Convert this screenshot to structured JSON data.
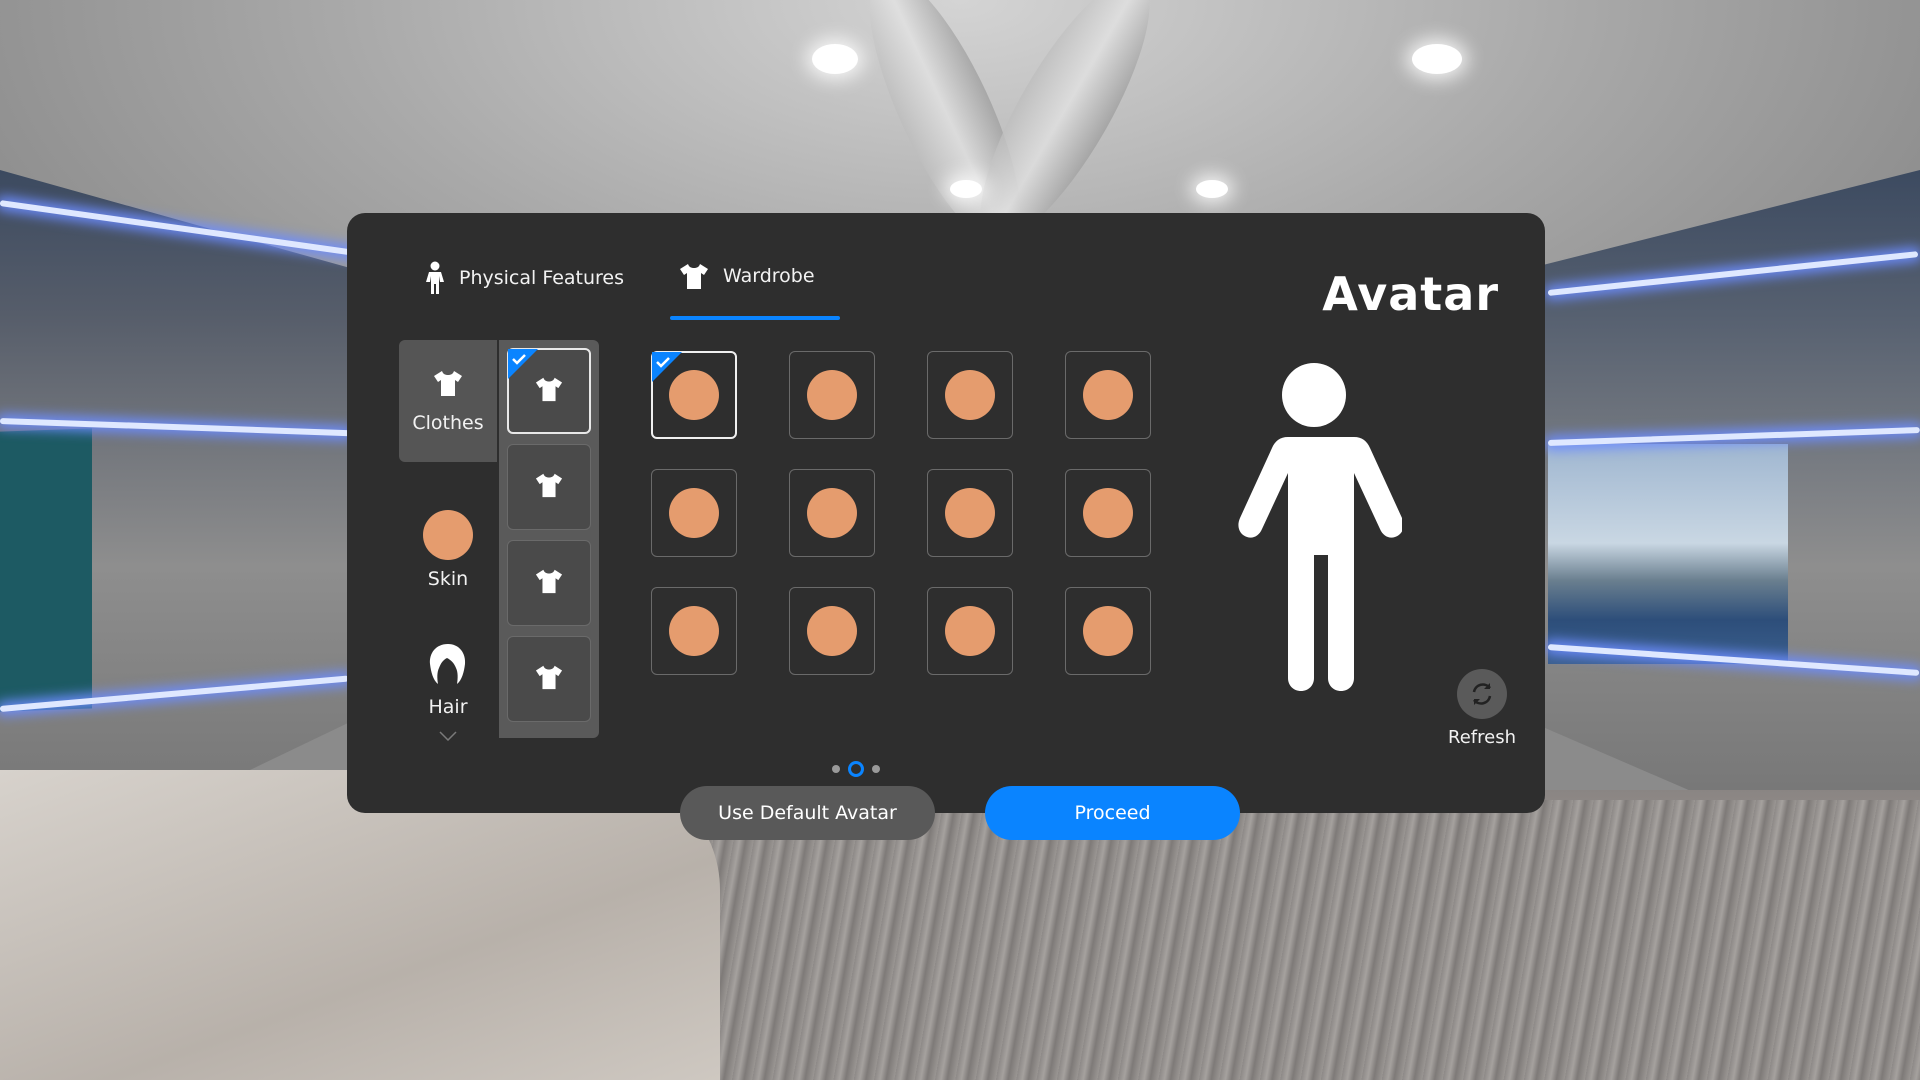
{
  "tabs": [
    {
      "label": "Physical Features",
      "icon": "person-icon"
    },
    {
      "label": "Wardrobe",
      "icon": "shirt-icon",
      "active": true
    }
  ],
  "title": "Avatar",
  "categories": {
    "clothes": {
      "label": "Clothes",
      "icon": "shirt-icon"
    },
    "skin": {
      "label": "Skin",
      "color": "#e59c6e"
    },
    "hair": {
      "label": "Hair",
      "icon": "hair-icon"
    }
  },
  "clothing_slots": 4,
  "selected_clothing_slot": 1,
  "swatch_grid": {
    "rows": 3,
    "columns": 4,
    "selected": 1,
    "color": "#e59c6e"
  },
  "refresh": {
    "label": "Refresh"
  },
  "pager": {
    "pages": 3,
    "current": 2
  },
  "buttons": {
    "default": "Use Default Avatar",
    "proceed": "Proceed"
  },
  "colors": {
    "accent": "#0a84ff",
    "panel": "#2e2e2e",
    "skin": "#e59c6e"
  }
}
